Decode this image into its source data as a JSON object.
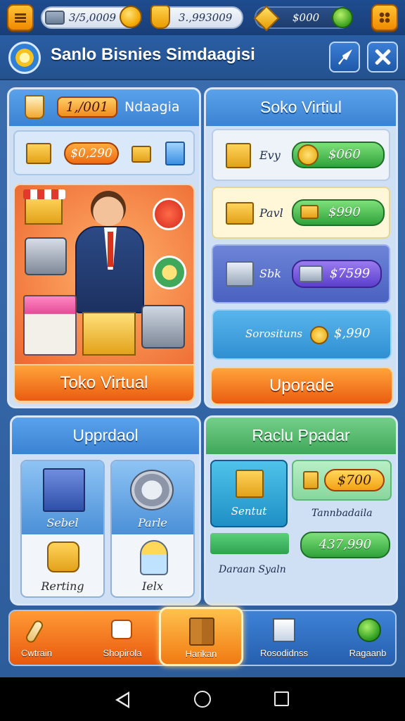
{
  "topbar": {
    "cash_value": "3/5,0009",
    "bag_value": "3.,993009",
    "gem_value": "$000"
  },
  "header": {
    "title": "Sanlo Bisnies  Simdaagisi"
  },
  "shop_panel": {
    "badge_value": "1,/001",
    "head_title": "Ndaagia",
    "price_chip": "$0,290",
    "button_label": "Toko Virtual"
  },
  "market_panel": {
    "title": "Soko Virtiul",
    "rows": [
      {
        "label": "Evy",
        "price": "$060"
      },
      {
        "label": "Pavl",
        "price": "$990"
      },
      {
        "label": "Sbk",
        "price": "$7599"
      }
    ],
    "summary_label": "Sorosituns",
    "summary_price": "$,990",
    "upgrade_label": "Uporade"
  },
  "upgrade_panel": {
    "title": "Upprdaol",
    "cards": [
      {
        "top_label": "Sebel",
        "bottom_label": "Rerting"
      },
      {
        "top_label": "Parle",
        "bottom_label": "Ielx"
      }
    ]
  },
  "report_panel": {
    "title": "Raclu Ppadar",
    "tile_label": "Sentut",
    "price": "$700",
    "sub_label": "Tannbadaila",
    "amount": "437,990",
    "footer_label": "Daraan Syaln"
  },
  "bottom_nav": {
    "items": [
      {
        "label": "Cwtrain",
        "icon": "microphone-icon"
      },
      {
        "label": "Shopirola",
        "icon": "camera-icon"
      },
      {
        "label": "Harikan",
        "icon": "cabinet-icon"
      },
      {
        "label": "Rosodidnss",
        "icon": "package-icon"
      },
      {
        "label": "Ragaanb",
        "icon": "green-orb-icon"
      }
    ]
  },
  "colors": {
    "background": "#2c5b99",
    "accent_orange": "#ef6b12",
    "accent_green": "#2fa23a",
    "accent_blue": "#3b82d3",
    "accent_purple": "#5b3fcb"
  }
}
